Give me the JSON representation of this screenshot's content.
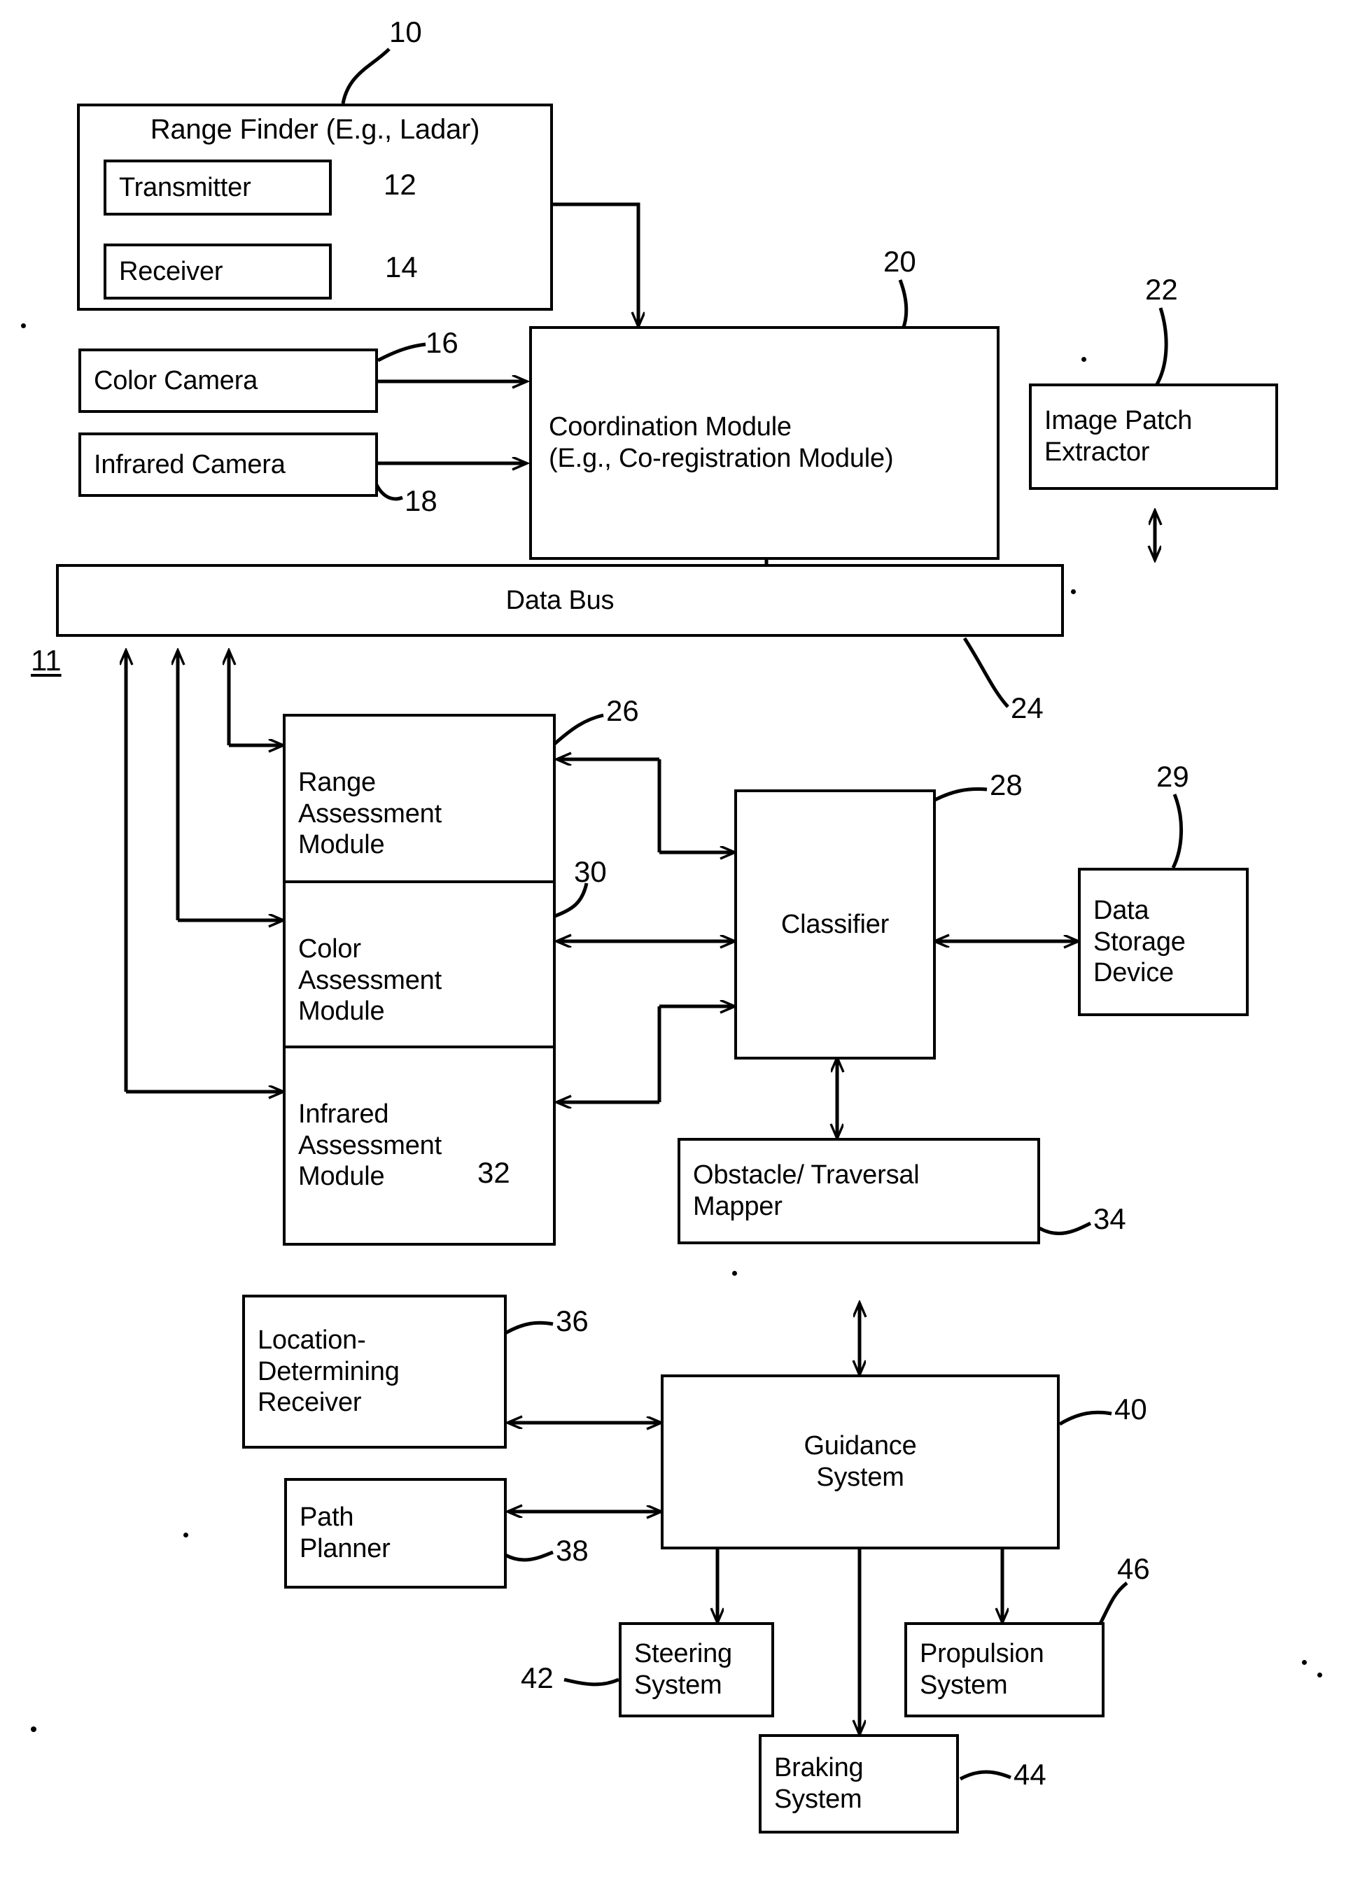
{
  "figure": {
    "type": "patent-block-diagram",
    "system_ref": "11"
  },
  "blocks": {
    "range_finder": {
      "label": "Range Finder (E.g., Ladar)",
      "ref": "10"
    },
    "transmitter": {
      "label": "Transmitter",
      "ref": "12"
    },
    "receiver": {
      "label": "Receiver",
      "ref": "14"
    },
    "color_camera": {
      "label": "Color Camera",
      "ref": "16"
    },
    "infrared_camera": {
      "label": "Infrared Camera",
      "ref": "18"
    },
    "coordination_module": {
      "label": "Coordination Module\n(E.g., Co-registration Module)",
      "ref": "20"
    },
    "image_patch_extractor": {
      "label": "Image Patch\nExtractor",
      "ref": "22"
    },
    "data_bus": {
      "label": "Data Bus",
      "ref": "24"
    },
    "range_assessment_module": {
      "label": "Range\nAssessment\nModule",
      "ref": "26"
    },
    "color_assessment_module": {
      "label": "Color\nAssessment\nModule",
      "ref": "30"
    },
    "infrared_assessment_module": {
      "label": "Infrared\nAssessment\nModule",
      "ref": "32"
    },
    "classifier": {
      "label": "Classifier",
      "ref": "28"
    },
    "data_storage_device": {
      "label": "Data\nStorage\nDevice",
      "ref": "29"
    },
    "obstacle_traversal_mapper": {
      "label": "Obstacle/ Traversal\nMapper",
      "ref": "34"
    },
    "location_determining_receiver": {
      "label": "Location-\nDetermining\nReceiver",
      "ref": "36"
    },
    "path_planner": {
      "label": "Path\nPlanner",
      "ref": "38"
    },
    "guidance_system": {
      "label": "Guidance\nSystem",
      "ref": "40"
    },
    "steering_system": {
      "label": "Steering\nSystem",
      "ref": "42"
    },
    "braking_system": {
      "label": "Braking\nSystem",
      "ref": "44"
    },
    "propulsion_system": {
      "label": "Propulsion\nSystem",
      "ref": "46"
    }
  }
}
